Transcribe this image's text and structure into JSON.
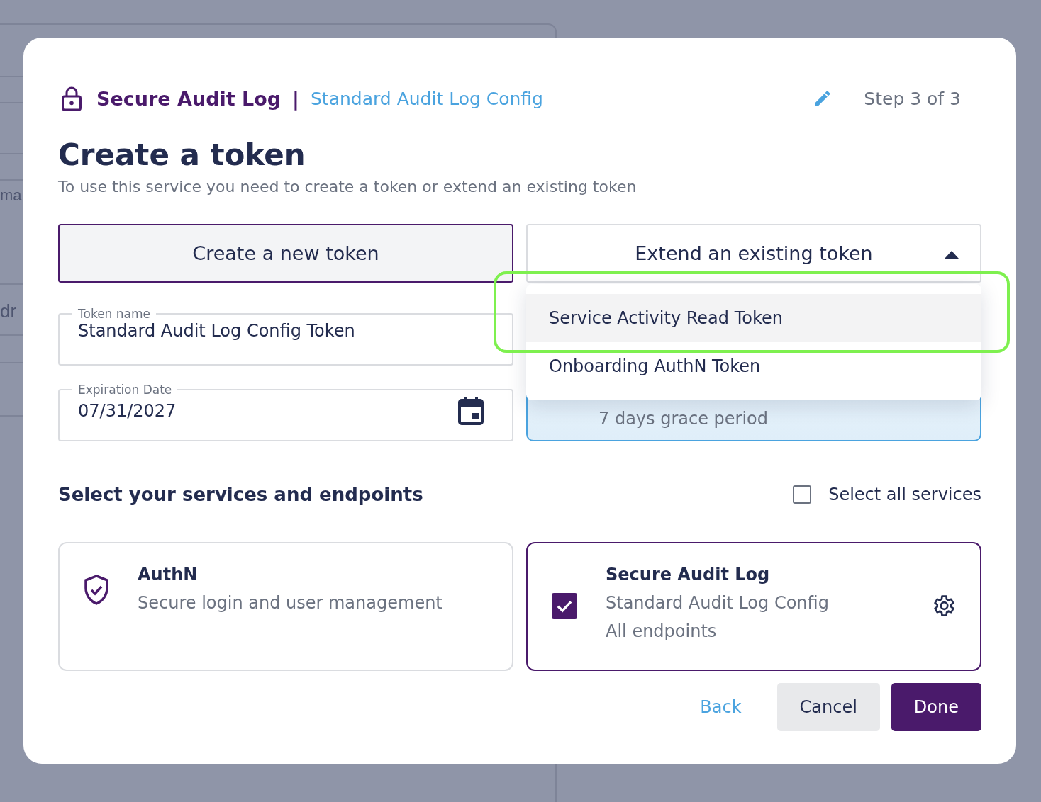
{
  "background": {
    "texts": [
      "ma",
      "dr"
    ]
  },
  "header": {
    "service": "Secure Audit Log",
    "separator": "|",
    "config": "Standard Audit Log Config",
    "step": "Step 3 of 3"
  },
  "title": "Create a token",
  "subtitle": "To use this service you need to create a token or extend an existing token",
  "mode_tabs": [
    {
      "label": "Create a new token",
      "selected": true,
      "kind": "button"
    },
    {
      "label": "Extend an existing token",
      "selected": false,
      "kind": "dropdown",
      "expanded": true
    }
  ],
  "fields": [
    {
      "label": "Token name",
      "value": "Standard Audit Log Config Token",
      "kind": "text"
    },
    {
      "label": "Expiration Date",
      "value": "07/31/2027",
      "kind": "date"
    }
  ],
  "info_panel": {
    "text": "7 days grace period"
  },
  "dropdown_options": [
    {
      "label": "Service Activity Read Token",
      "selected": true,
      "annotated": true
    },
    {
      "label": "Onboarding AuthN Token",
      "selected": false,
      "annotated": false
    }
  ],
  "services": {
    "heading": "Select your services and endpoints",
    "select_all": {
      "label": "Select all services",
      "checked": false
    },
    "items": [
      {
        "name": "AuthN",
        "lines": [
          "Secure login and user management"
        ],
        "checked": false
      },
      {
        "name": "Secure Audit Log",
        "lines": [
          "Standard Audit Log Config",
          "All endpoints"
        ],
        "checked": true
      }
    ]
  },
  "actions": [
    {
      "label": "Back",
      "kind": "link"
    },
    {
      "label": "Cancel",
      "kind": "secondary"
    },
    {
      "label": "Done",
      "kind": "primary"
    }
  ]
}
